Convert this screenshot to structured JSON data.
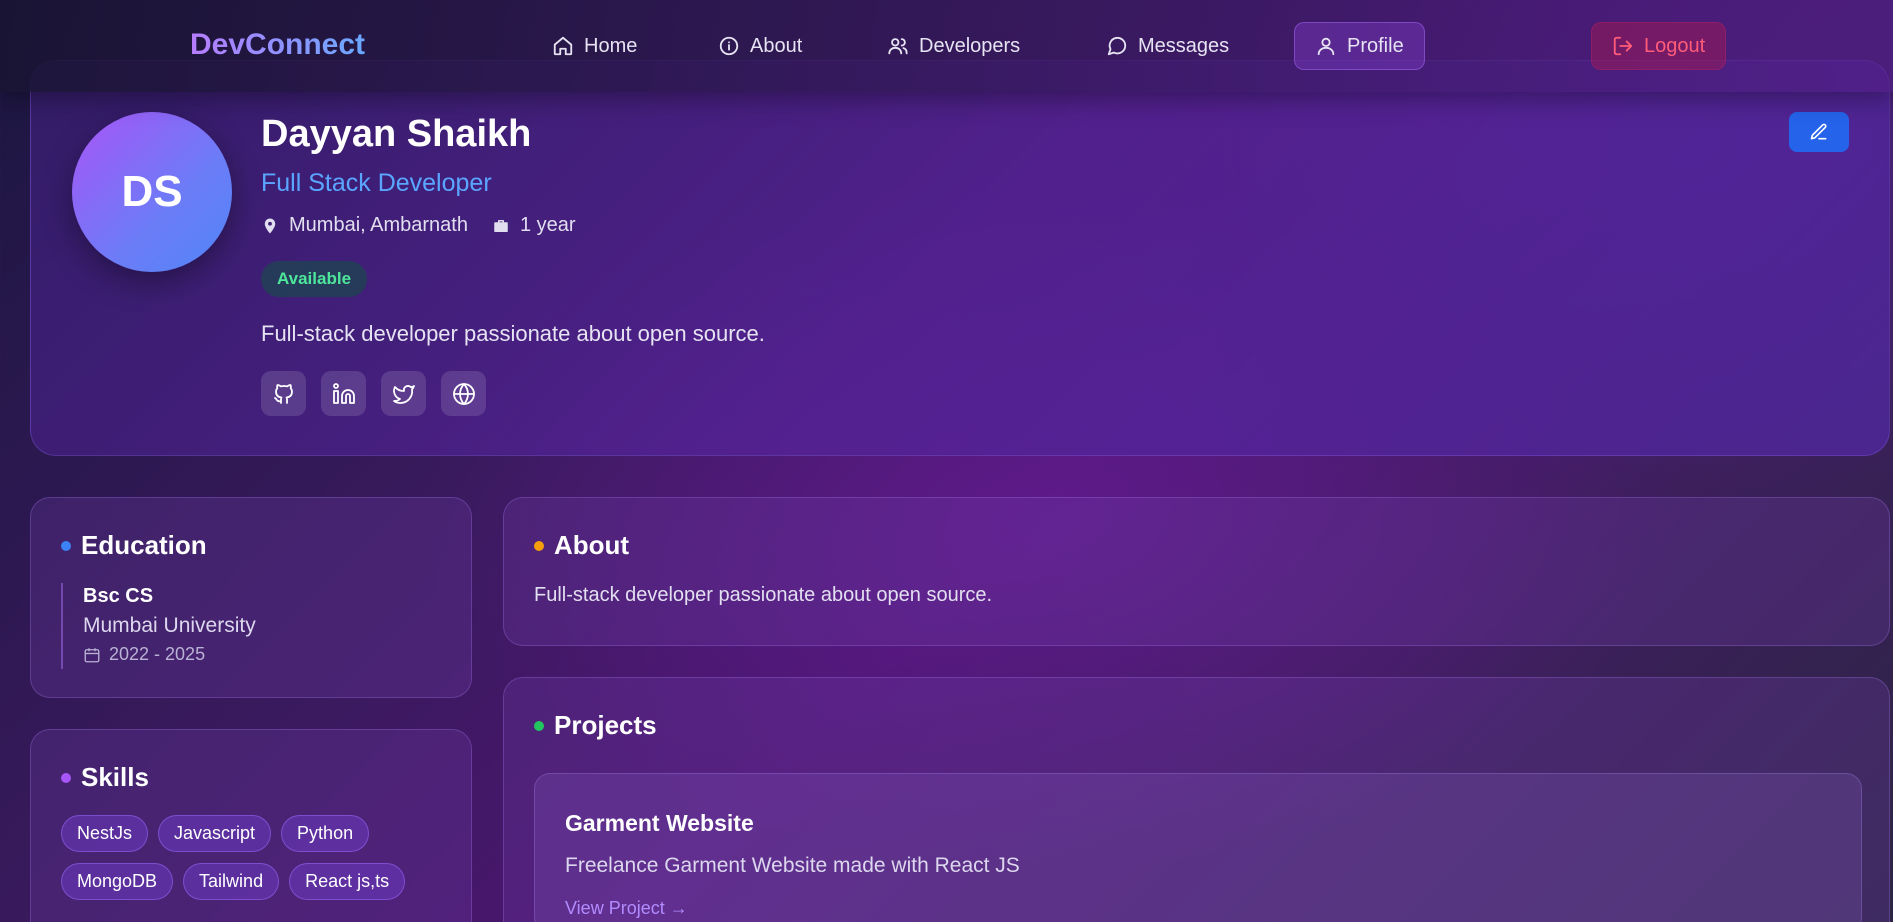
{
  "header": {
    "logo": "DevConnect",
    "nav": [
      {
        "label": "Home",
        "icon": "home-icon"
      },
      {
        "label": "About",
        "icon": "info-icon"
      },
      {
        "label": "Developers",
        "icon": "users-icon"
      },
      {
        "label": "Messages",
        "icon": "message-icon"
      },
      {
        "label": "Profile",
        "icon": "user-icon",
        "active": true
      }
    ],
    "logout": "Logout"
  },
  "profile": {
    "initials": "DS",
    "name": "Dayyan Shaikh",
    "role": "Full Stack Developer",
    "location": "Mumbai, Ambarnath",
    "experience": "1 year",
    "status": "Available",
    "bio": "Full-stack developer passionate about open source.",
    "socials": [
      "github-icon",
      "linkedin-icon",
      "twitter-icon",
      "globe-icon"
    ]
  },
  "education": {
    "title": "Education",
    "degree": "Bsc CS",
    "school": "Mumbai University",
    "years": "2022 - 2025"
  },
  "skills": {
    "title": "Skills",
    "items": [
      "NestJs",
      "Javascript",
      "Python",
      "MongoDB",
      "Tailwind",
      "React js,ts"
    ]
  },
  "about": {
    "title": "About",
    "text": "Full-stack developer passionate about open source."
  },
  "projects": {
    "title": "Projects",
    "items": [
      {
        "title": "Garment Website",
        "description": "Freelance Garment Website made with React JS",
        "link": "View Project →"
      }
    ]
  },
  "colors": {
    "accent": "#2563eb",
    "role": "#5aa6ff",
    "available": "#4ee69a",
    "logout": "#ff5c7a",
    "education_dot": "#3b82f6",
    "skills_dot": "#a855f7",
    "about_dot": "#f59e0b",
    "projects_dot": "#22c55e"
  }
}
